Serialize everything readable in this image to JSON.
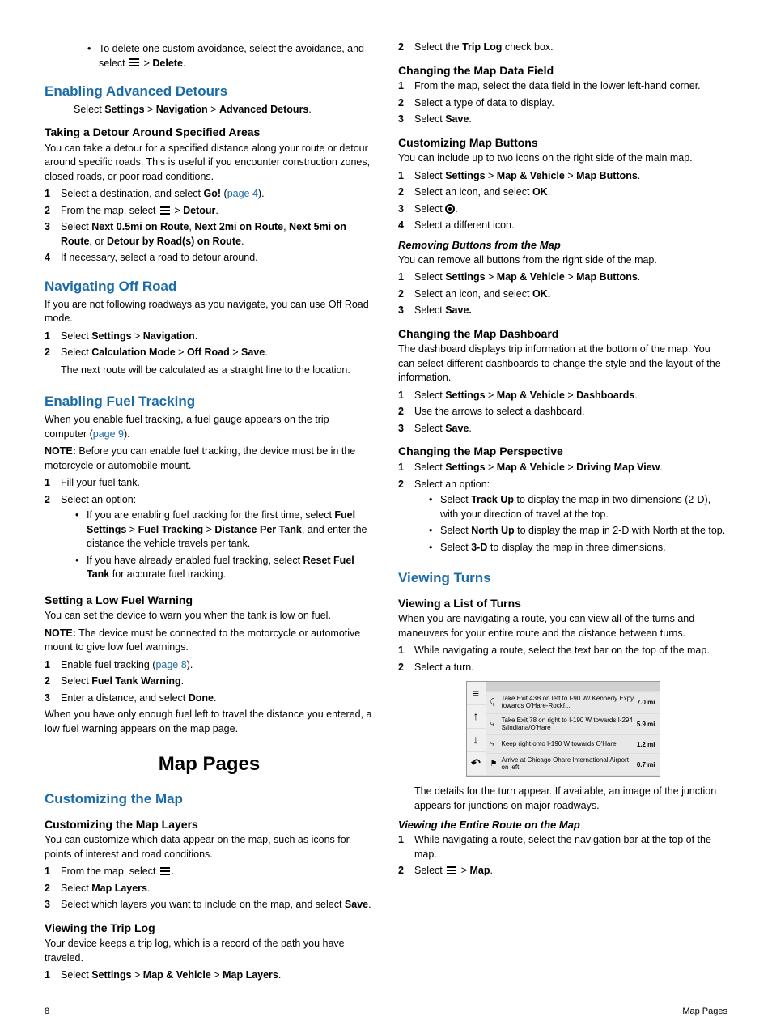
{
  "left": {
    "deleteAvoidance": {
      "text1": "To delete one custom avoidance, select the avoidance, and select ",
      "menuSep": " > ",
      "delete": "Delete",
      "period": "."
    },
    "advDetours": {
      "heading": "Enabling Advanced Detours",
      "instr_pre": "Select ",
      "settings": "Settings",
      "sep": " > ",
      "navigation": "Navigation",
      "advDet": "Advanced Detours",
      "period": ".",
      "sub": "Taking a Detour Around Specified Areas",
      "intro": "You can take a detour for a specified distance along your route or detour around specific roads. This is useful if you encounter construction zones, closed roads, or poor road conditions.",
      "s1a": "Select a destination, and select ",
      "s1b": "Go!",
      "s1c": " (",
      "s1link": "page 4",
      "s1d": ").",
      "s2a": "From the map, select ",
      "s2b": " > ",
      "s2c": "Detour",
      "s2d": ".",
      "s3a": "Select ",
      "s3b": "Next 0.5mi on Route",
      "s3c": ", ",
      "s3d": "Next 2mi on Route",
      "s3e": ", ",
      "s3f": "Next 5mi on Route",
      "s3g": ", or ",
      "s3h": "Detour by Road(s) on Route",
      "s3i": ".",
      "s4": "If necessary, select a road to detour around."
    },
    "offRoad": {
      "heading": "Navigating Off Road",
      "intro": "If you are not following roadways as you navigate, you can use Off Road mode.",
      "s1a": "Select ",
      "s1b": "Settings",
      "s1c": " > ",
      "s1d": "Navigation",
      "s1e": ".",
      "s2a": "Select ",
      "s2b": "Calculation Mode",
      "s2c": " > ",
      "s2d": "Off Road",
      "s2e": " > ",
      "s2f": "Save",
      "s2g": ".",
      "s2note": "The next route will be calculated as a straight line to the location."
    },
    "fuel": {
      "heading": "Enabling Fuel Tracking",
      "intro1": "When you enable fuel tracking, a fuel gauge appears on the trip computer (",
      "introLink": "page 9",
      "intro2": ").",
      "noteLabel": "NOTE:",
      "note": " Before you can enable fuel tracking, the device must be in the motorcycle or automobile mount.",
      "s1": "Fill your fuel tank.",
      "s2": "Select an option:",
      "s2b1a": "If you are enabling fuel tracking for the first time, select ",
      "s2b1b": "Fuel Settings",
      "s2b1c": " > ",
      "s2b1d": "Fuel Tracking",
      "s2b1e": " > ",
      "s2b1f": "Distance Per Tank",
      "s2b1g": ", and enter the distance the vehicle travels per tank.",
      "s2b2a": "If you have already enabled fuel tracking, select ",
      "s2b2b": "Reset Fuel Tank",
      "s2b2c": " for accurate fuel tracking.",
      "lowFuel": {
        "heading": "Setting a Low Fuel Warning",
        "intro": "You can set the device to warn you when the tank is low on fuel.",
        "noteLabel": "NOTE:",
        "note": " The device must be connected to the motorcycle or automotive mount to give low fuel warnings.",
        "s1a": "Enable fuel tracking (",
        "s1link": "page 8",
        "s1b": ").",
        "s2a": "Select ",
        "s2b": "Fuel Tank Warning",
        "s2c": ".",
        "s3a": "Enter a distance, and select ",
        "s3b": "Done",
        "s3c": ".",
        "tail": "When you have only enough fuel left to travel the distance you entered, a low fuel warning appears on the map page."
      }
    },
    "mapPages": "Map Pages",
    "custMap": {
      "heading": "Customizing the Map",
      "layers": {
        "heading": "Customizing the Map Layers",
        "intro": "You can customize which data appear on the map, such as icons for points of interest and road conditions.",
        "s1a": "From the map, select ",
        "s1b": ".",
        "s2a": "Select ",
        "s2b": "Map Layers",
        "s2c": ".",
        "s3a": "Select which layers you want to include on the map, and select ",
        "s3b": "Save",
        "s3c": "."
      },
      "tripLog": {
        "heading": "Viewing the Trip Log",
        "intro": "Your device keeps a trip log, which is a record of the path you have traveled.",
        "s1a": "Select ",
        "s1b": "Settings",
        "s1c": " > ",
        "s1d": "Map & Vehicle",
        "s1e": " > ",
        "s1f": "Map Layers",
        "s1g": "."
      }
    }
  },
  "right": {
    "tripLogCont": {
      "s2a": "Select the ",
      "s2b": "Trip Log",
      "s2c": " check box."
    },
    "dataField": {
      "heading": "Changing the Map Data Field",
      "s1": "From the map, select the data field in the lower left-hand corner.",
      "s2": "Select a type of data to display.",
      "s3a": "Select ",
      "s3b": "Save",
      "s3c": "."
    },
    "mapButtons": {
      "heading": "Customizing Map Buttons",
      "intro": "You can include up to two icons on the right side of the main map.",
      "s1a": "Select ",
      "s1b": "Settings",
      "s1c": " > ",
      "s1d": "Map & Vehicle",
      "s1e": " > ",
      "s1f": "Map Buttons",
      "s1g": ".",
      "s2a": "Select an icon, and select ",
      "s2b": "OK",
      "s2c": ".",
      "s3a": "Select ",
      "s3b": ".",
      "s4": "Select a different icon.",
      "removing": {
        "heading": "Removing Buttons from the Map",
        "intro": "You can remove all buttons from the right side of the map.",
        "s1a": "Select ",
        "s1b": "Settings",
        "s1c": " > ",
        "s1d": "Map & Vehicle",
        "s1e": " > ",
        "s1f": "Map Buttons",
        "s1g": ".",
        "s2a": "Select an icon, and select ",
        "s2b": "OK.",
        "s3a": "Select ",
        "s3b": "Save.",
        "s3c": ""
      }
    },
    "dashboard": {
      "heading": "Changing the Map Dashboard",
      "intro": "The dashboard displays trip information at the bottom of the map. You can select different dashboards to change the style and the layout of the information.",
      "s1a": "Select ",
      "s1b": "Settings",
      "s1c": " > ",
      "s1d": "Map & Vehicle",
      "s1e": " > ",
      "s1f": "Dashboards",
      "s1g": ".",
      "s2": "Use the arrows to select a dashboard.",
      "s3a": "Select ",
      "s3b": "Save",
      "s3c": "."
    },
    "perspective": {
      "heading": "Changing the Map Perspective",
      "s1a": "Select ",
      "s1b": "Settings",
      "s1c": " > ",
      "s1d": "Map & Vehicle",
      "s1e": " > ",
      "s1f": "Driving Map View",
      "s1g": ".",
      "s2": "Select an option:",
      "b1a": "Select ",
      "b1b": "Track Up",
      "b1c": " to display the map in two dimensions (2-D), with your direction of travel at the top.",
      "b2a": "Select ",
      "b2b": "North Up",
      "b2c": " to display the map in 2-D with North at the top.",
      "b3a": "Select ",
      "b3b": "3-D",
      "b3c": " to display the map in three dimensions."
    },
    "viewingTurns": {
      "heading": "Viewing Turns",
      "list": {
        "heading": "Viewing a List of Turns",
        "intro": "When you are navigating a route, you can view all of the turns and maneuvers for your entire route and the distance between turns.",
        "s1": "While navigating a route, select the text bar on the top of the map.",
        "s2": "Select a turn.",
        "tail": "The details for the turn appear. If available, an image of the junction appears for junctions on major roadways."
      },
      "entire": {
        "heading": "Viewing the Entire Route on the Map",
        "s1": "While navigating a route, select the navigation bar at the top of the map.",
        "s2a": "Select ",
        "s2b": " > ",
        "s2c": "Map",
        "s2d": "."
      }
    },
    "screenshot": {
      "rows": [
        {
          "text": "Take Exit 43B on left to I-90 W/ Kennedy Expy towards O'Hare-Rockf...",
          "dist": "7.0 mi"
        },
        {
          "text": "Take Exit 78 on right to I-190 W towards I-294 S/Indiana/O'Hare",
          "dist": "5.9 mi"
        },
        {
          "text": "Keep right onto I-190 W towards O'Hare",
          "dist": "1.2 mi"
        },
        {
          "text": "Arrive at Chicago Ohare International Airport on left",
          "dist": "0.7 mi"
        }
      ]
    }
  },
  "footer": {
    "pageNum": "8",
    "section": "Map Pages"
  }
}
